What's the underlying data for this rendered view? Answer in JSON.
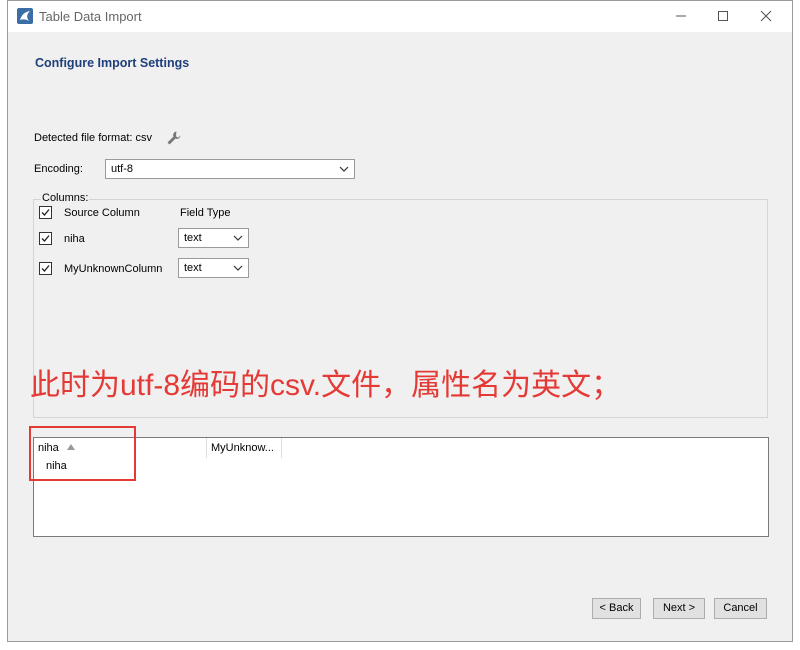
{
  "window": {
    "title": "Table Data Import"
  },
  "page": {
    "heading": "Configure Import Settings"
  },
  "detected": {
    "label": "Detected file format: csv"
  },
  "encoding": {
    "label": "Encoding:",
    "value": "utf-8"
  },
  "columns": {
    "group_label": "Columns:",
    "header": {
      "source": "Source Column",
      "field_type": "Field Type",
      "checked": true
    },
    "rows": [
      {
        "name": "niha",
        "type": "text",
        "checked": true
      },
      {
        "name": "MyUnknownColumn",
        "type": "text",
        "checked": true
      }
    ]
  },
  "annotation": {
    "text": "此时为utf-8编码的csv.文件，属性名为英文；",
    "color": "#e53935"
  },
  "preview": {
    "columns": [
      "niha",
      "MyUnknow..."
    ],
    "rows": [
      [
        "niha",
        ""
      ]
    ]
  },
  "buttons": {
    "back": "< Back",
    "next": "Next >",
    "cancel": "Cancel"
  },
  "colors": {
    "heading": "#1e3f7a",
    "annotation": "#e53935"
  }
}
